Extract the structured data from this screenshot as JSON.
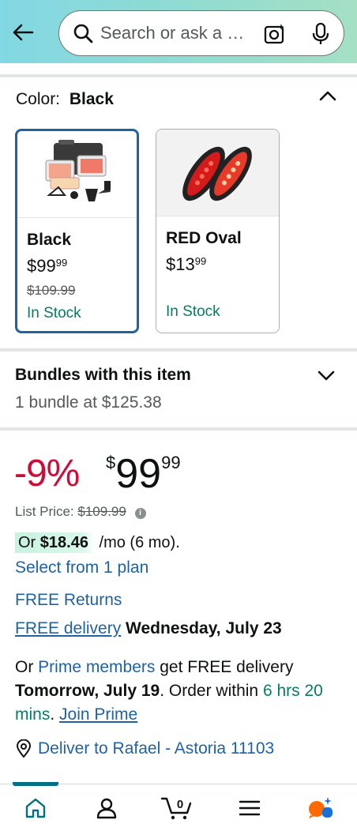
{
  "search": {
    "placeholder": "Search or ask a question"
  },
  "color_selector": {
    "label": "Color:",
    "selected": "Black",
    "options": [
      {
        "name": "Black",
        "price_dollars": "$99",
        "price_cents": "99",
        "list_price": "$109.99",
        "stock": "In Stock",
        "selected": true
      },
      {
        "name": "RED Oval",
        "price_dollars": "$13",
        "price_cents": "99",
        "list_price": "",
        "stock": "In Stock",
        "selected": false
      }
    ]
  },
  "bundles": {
    "title": "Bundles with this item",
    "subtitle": "1 bundle at $125.38"
  },
  "pricing": {
    "discount": "-9%",
    "currency": "$",
    "dollars": "99",
    "cents": "99",
    "list_price_label": "List Price:",
    "list_price": "$109.99",
    "info_glyph": "i"
  },
  "monthly": {
    "prefix": "Or",
    "amount": "$18.46",
    "suffix": "/mo (6 mo).",
    "select_plan": "Select from 1 plan"
  },
  "delivery": {
    "free_returns": "FREE Returns",
    "free_delivery_link": "FREE delivery",
    "free_delivery_date": "Wednesday, July 23",
    "prime_or": "Or",
    "prime_members": "Prime members",
    "prime_text": "get FREE delivery",
    "prime_date": "Tomorrow, July 19",
    "order_within": ". Order within",
    "countdown": "6 hrs 20 mins",
    "join_prime": "Join Prime",
    "deliver_to": "Deliver to Rafael - Astoria 11103"
  },
  "bottom_nav": {
    "cart_count": "0",
    "items": [
      "home-icon",
      "account-icon",
      "cart-icon",
      "menu-icon",
      "rufus-icon"
    ]
  },
  "colors": {
    "link": "#2162a1",
    "deal_red": "#cc0c39",
    "stock_green": "#067d62",
    "header_start": "#82d8e3",
    "header_end": "#a5e0c4"
  }
}
